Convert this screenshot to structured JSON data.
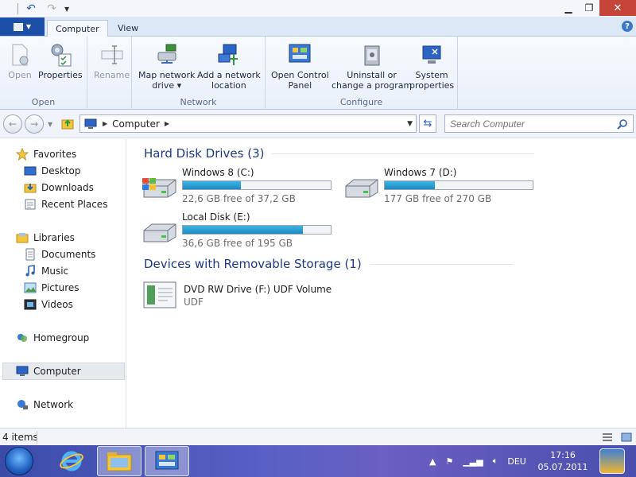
{
  "ribbon": {
    "tabs": [
      {
        "label": "Computer"
      },
      {
        "label": "View"
      }
    ],
    "groups": [
      {
        "label": "Open",
        "buttons": [
          {
            "label": "Open"
          },
          {
            "label": "Properties"
          }
        ]
      },
      {
        "label": "",
        "buttons": [
          {
            "label": "Rename"
          }
        ]
      },
      {
        "label": "Network",
        "buttons": [
          {
            "line1": "Map network",
            "line2": "drive ▾"
          },
          {
            "line1": "Add a network",
            "line2": "location"
          }
        ]
      },
      {
        "label": "Configure",
        "buttons": [
          {
            "line1": "Open Control",
            "line2": "Panel"
          },
          {
            "line1": "Uninstall or",
            "line2": "change a program"
          },
          {
            "line1": "System",
            "line2": "properties"
          }
        ]
      }
    ]
  },
  "address": {
    "path": "Computer",
    "search_placeholder": "Search Computer"
  },
  "sidebar": {
    "favorites": "Favorites",
    "favorites_items": [
      "Desktop",
      "Downloads",
      "Recent Places"
    ],
    "libraries": "Libraries",
    "libraries_items": [
      "Documents",
      "Music",
      "Pictures",
      "Videos"
    ],
    "homegroup": "Homegroup",
    "computer": "Computer",
    "network": "Network"
  },
  "content": {
    "hdd_header": "Hard Disk Drives (3)",
    "drives": [
      {
        "name": "Windows 8 (C:)",
        "free": "22,6 GB free of 37,2 GB",
        "used_fraction": 0.39
      },
      {
        "name": "Windows 7  (D:)",
        "free": "177 GB free of 270 GB",
        "used_fraction": 0.34
      },
      {
        "name": "Local Disk (E:)",
        "free": "36,6 GB free of 195 GB",
        "used_fraction": 0.81
      }
    ],
    "removable_header": "Devices with Removable Storage (1)",
    "dvd": {
      "name": "DVD RW Drive (F:) UDF Volume",
      "fs": "UDF"
    }
  },
  "status": {
    "count": "4 items"
  },
  "taskbar": {
    "language": "DEU",
    "time": "17:16",
    "date": "05.07.2011"
  },
  "colors": {
    "accent": "#1b4fa8",
    "header_text": "#1e3a87",
    "bar_fill": "#1b8bc3"
  }
}
